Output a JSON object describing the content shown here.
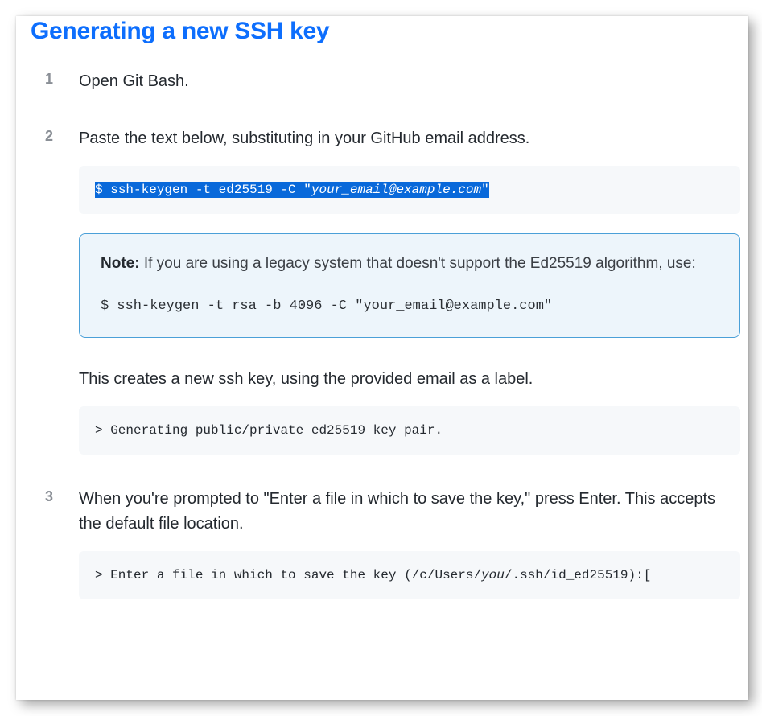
{
  "title": "Generating a new SSH key",
  "step1": {
    "text": "Open Git Bash."
  },
  "step2": {
    "text": "Paste the text below, substituting in your GitHub email address.",
    "cmd_prefix": "$",
    "cmd_main": " ssh-keygen -t ed25519 -C \"",
    "cmd_email": "your_email@example.com",
    "cmd_suffix": "\"",
    "note_label": "Note:",
    "note_body": " If you are using a legacy system that doesn't support the Ed25519 algorithm, use:",
    "note_cmd": "$ ssh-keygen -t rsa -b 4096 -C \"your_email@example.com\"",
    "followup": "This creates a new ssh key, using the provided email as a label.",
    "output": "> Generating public/private ed25519 key pair."
  },
  "step3": {
    "text": "When you're prompted to \"Enter a file in which to save the key,\" press Enter. This accepts the default file location.",
    "output_prefix": "> Enter a file in which to save the key (/c/Users/",
    "output_you": "you",
    "output_suffix": "/.ssh/id_ed25519):["
  }
}
